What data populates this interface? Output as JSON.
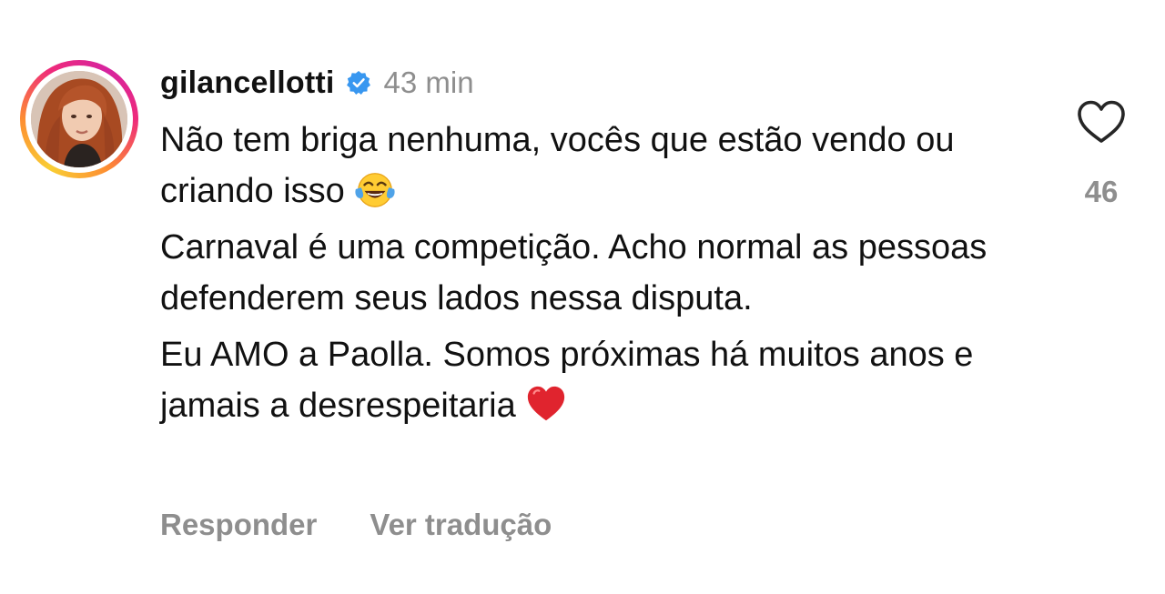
{
  "comment": {
    "username": "gilancellotti",
    "verified": true,
    "timestamp": "43 min",
    "paragraphs": [
      {
        "text": "Não tem briga nenhuma, vocês que estão vendo ou criando isso",
        "emoji": "face-with-tears-of-joy"
      },
      {
        "text": "Carnaval é uma competição. Acho normal as pessoas defenderem seus lados nessa disputa."
      },
      {
        "text": "Eu AMO a Paolla. Somos próximas há muitos anos e jamais a desrespeitaria",
        "emoji": "red-heart"
      }
    ],
    "actions": {
      "reply_label": "Responder",
      "translate_label": "Ver tradução"
    },
    "likes": {
      "count": "46",
      "icon": "heart-outline-icon"
    }
  },
  "colors": {
    "text": "#111111",
    "secondary": "#8e8e8e",
    "verified_blue": "#3897f0",
    "story_ring": [
      "#f9ce34",
      "#ee2a7b",
      "#d6249f"
    ]
  }
}
